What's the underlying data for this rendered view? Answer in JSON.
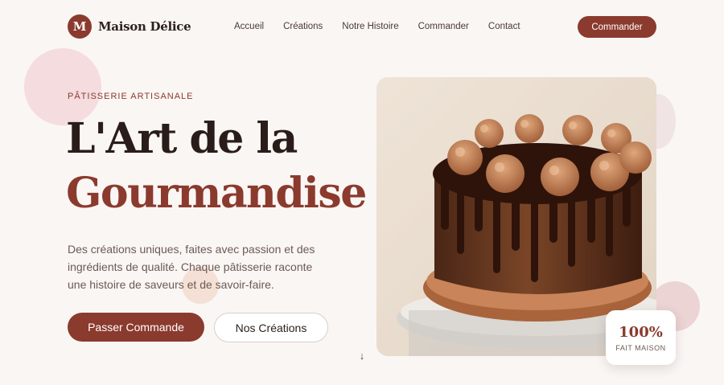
{
  "brand": {
    "logo_letter": "M",
    "name": "Maison Délice"
  },
  "nav": {
    "items": [
      {
        "label": "Accueil"
      },
      {
        "label": "Créations"
      },
      {
        "label": "Notre Histoire"
      },
      {
        "label": "Commander"
      },
      {
        "label": "Contact"
      }
    ],
    "cta_label": "Commander"
  },
  "hero": {
    "eyebrow": "PÂTISSERIE ARTISANALE",
    "headline_line1": "L'Art de la",
    "headline_line2": "Gourmandise",
    "description": "Des créations uniques, faites avec passion et des ingrédients de qualité. Chaque pâtisserie raconte une histoire de saveurs et de savoir-faire.",
    "primary_button": "Passer Commande",
    "secondary_button": "Nos Créations",
    "scroll_icon": "arrow-down-icon"
  },
  "badge": {
    "value": "100%",
    "label": "FAIT MAISON"
  },
  "colors": {
    "accent": "#8b3a2e",
    "background": "#faf6f4",
    "heading_dark": "#2a1d19",
    "body_text": "#6b5a54"
  }
}
